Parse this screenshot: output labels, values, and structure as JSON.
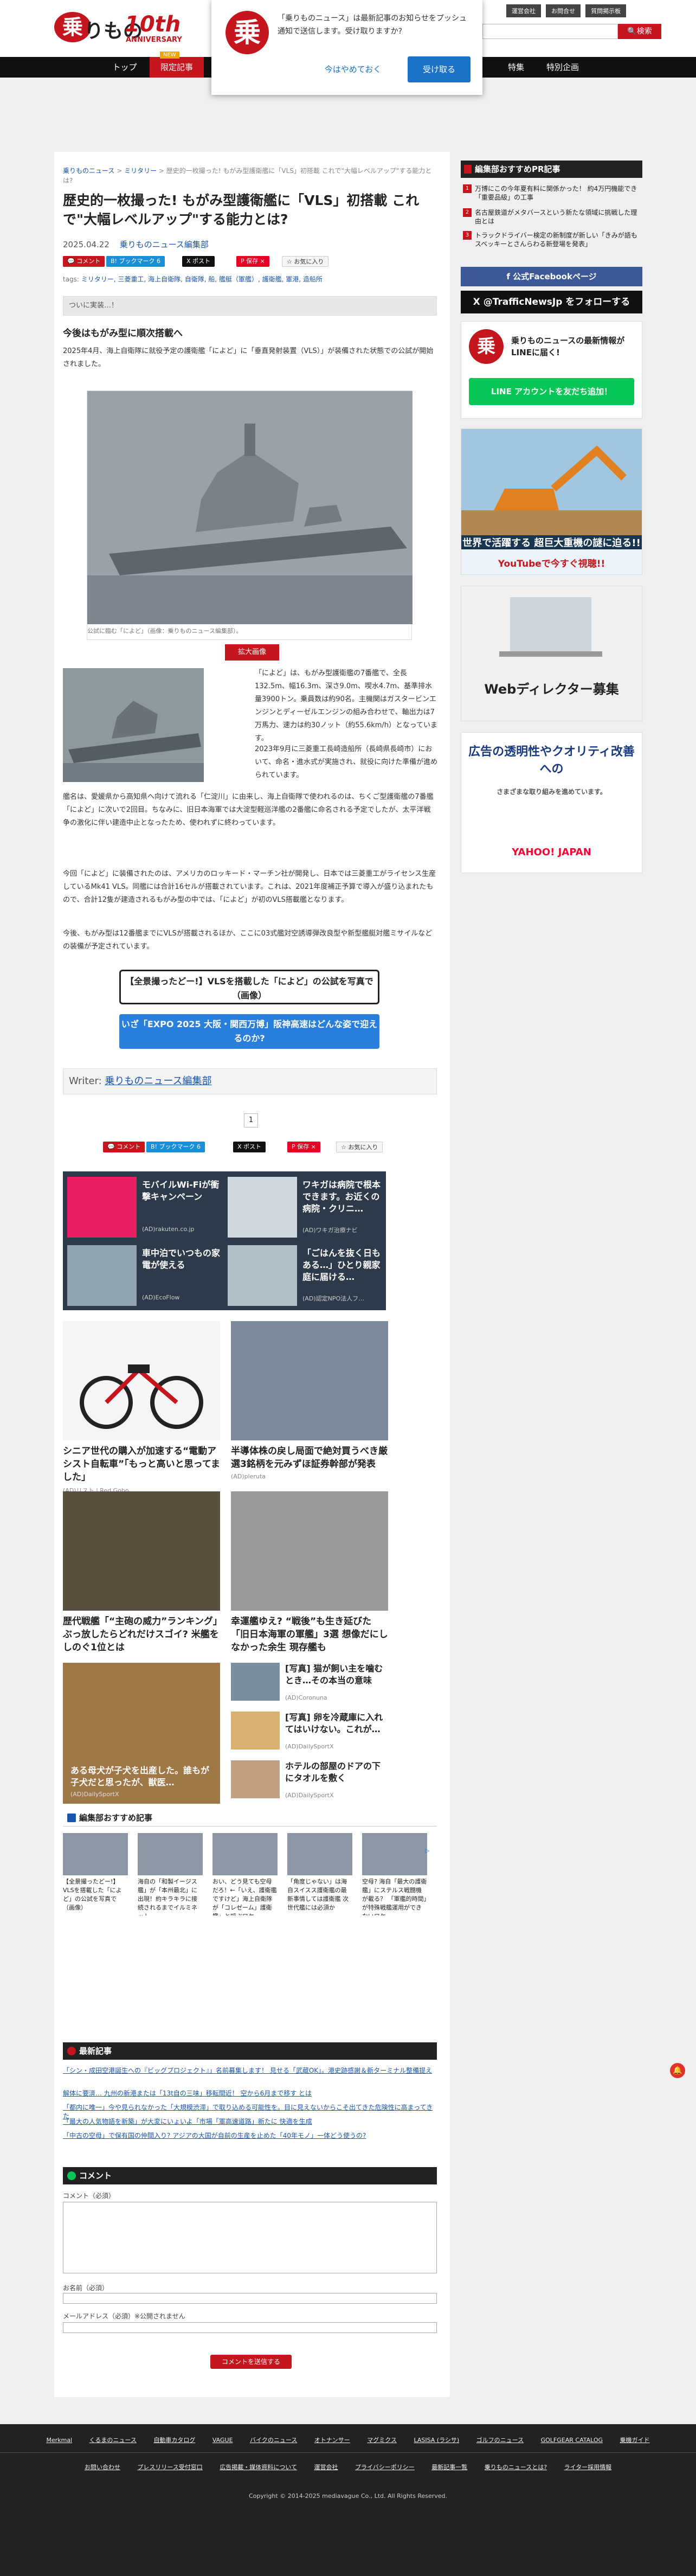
{
  "header": {
    "logo_mark": "乗",
    "logo_text": "りもの",
    "logo_sub": "ニュース",
    "logo_10th": "10th",
    "logo_anniversary": "ANNIVERSARY",
    "top_links": [
      "運営会社",
      "お問合せ",
      "質問掲示板"
    ],
    "search_placeholder": "",
    "search_button": "🔍検索"
  },
  "nav": {
    "items": [
      "トップ",
      "限定記事",
      "",
      "",
      "",
      "",
      "",
      "",
      "",
      "特集",
      "特別企画"
    ],
    "new_tag": "NEW"
  },
  "notification": {
    "logo": "乗",
    "message": "「乗りものニュース」は最新記事のお知らせをプッシュ通知で送信します。受け取りますか?",
    "later": "今はやめておく",
    "accept": "受け取る"
  },
  "article": {
    "breadcrumb": {
      "home": "乗りものニュース",
      "cat": "ミリタリー",
      "current": "歴史的一枚撮った! もがみ型護衛艦に「VLS」初搭載 これで\"大幅レベルアップ\"する能力とは?"
    },
    "title": "歴史的一枚撮った! もがみ型護衛艦に「VLS」初搭載 これで\"大幅レベルアップ\"する能力とは?",
    "date": "2025.04.22",
    "author": "乗りものニュース編集部",
    "sns": [
      "💬 コメント",
      "B! ブックマーク 6",
      "X ポスト",
      "P 保存 ×",
      "☆ お気に入り"
    ],
    "tags_label": "tags:",
    "tags": "ミリタリー, 三菱重工, 海上自衛隊, 自衛隊, 船, 艦艇（軍艦）, 護衛艦, 軍港, 造船所",
    "lead": "ついに実装…！",
    "h2": "今後はもがみ型に順次搭載へ",
    "para1": "2025年4月、海上自衛隊に就役予定の護衛艦「によど」に「垂直発射装置（VLS）」が装備された状態での公試が開始されました。",
    "photo_caption": "公試に臨む「によど」（画像：乗りものニュース編集部）。",
    "enlarge": "拡大画像",
    "para2": "「によど」は、もがみ型護衛艦の7番艦で、全長132.5m、幅16.3m、深さ9.0m、喫水4.7m、基準排水量3900トン。乗員数は約90名。主機関はガスタービンエンジンとディーゼルエンジンの組み合わせで、軸出力は7万馬力、速力は約30ノット（約55.6km/h）となっています。",
    "para3": "2023年9月に三菱重工長崎造船所（長崎県長崎市）において、命名・進水式が実施され、就役に向けた準備が進められています。",
    "para4": "艦名は、愛媛県から高知県へ向けて流れる「仁淀川」に由来し、海上自衛隊で使われるのは、ちくご型護衛艦の7番艦「によど」に次いで2回目。ちなみに、旧日本海軍では大淀型軽巡洋艦の2番艦に命名される予定でしたが、太平洋戦争の激化に伴い建造中止となったため、使われずに終わっています。",
    "para5": "今回「によど」に装備されたのは、アメリカのロッキード・マーチン社が開発し、日本では三菱重工がライセンス生産しているMk41 VLS。同艦には合計16セルが搭載されています。これは、2021年度補正予算で導入が盛り込まれたもので、合計12隻が建造されるもがみ型の中では、「によど」が初のVLS搭載艦となります。",
    "para6": "今後、もがみ型は12番艦までにVLSが搭載されるほか、ここに03式艦対空誘導弾改良型や新型艦艇対艦ミサイルなどの装備が予定されています。",
    "link1": "【全景撮ったどー!】VLSを搭載した「によど」の公試を写真で（画像）",
    "link2": "いざ「EXPO 2025 大阪・関西万博」阪神高速はどんな姿で迎えるのか?",
    "writer_label": "Writer:",
    "writer_name": "乗りものニュース編集部",
    "page": "1",
    "sns2": [
      "💬 コメント",
      "B! ブックマーク 6",
      "X ポスト",
      "P 保存 ×",
      "☆ お気に入り"
    ]
  },
  "ads": {
    "grid": [
      {
        "title": "モバイルWi-Fiが衝撃キャンペーン",
        "src": "(AD)rakuten.co.jp",
        "color": "#e91e63"
      },
      {
        "title": "ワキガは病院で根本できます。お近くの病院・クリニ…",
        "src": "(AD)ワキガ治療ナビ",
        "color": "#cfd8dc"
      },
      {
        "title": "車中泊でいつもの家電が使える",
        "src": "(AD)EcoFlow",
        "color": "#90a4ae"
      },
      {
        "title": "「ごはんを抜く日もある…」ひとり親家庭に届ける…",
        "src": "(AD)認定NPO法人フ…",
        "color": "#b0bec5"
      }
    ],
    "pair1": [
      {
        "title": "シニア世代の購入が加速する“電動アシスト自転車”「もっと高いと思ってました」",
        "src": "(AD)リスト | Red Gobo",
        "color": "#f5f5f5"
      },
      {
        "title": "半導体株の戻し局面で絶対買うべき厳選3銘柄を元みずほ証券幹部が発表",
        "src": "(AD)pleruta",
        "color": "#7a8a9a"
      }
    ],
    "pair2": [
      {
        "title": "歴代戦艦「“主砲の威力”ランキング」ぶっ放したらどれだけスゴイ? 米艦をしのぐ1位とは",
        "src": "",
        "color": "#5a5040"
      },
      {
        "title": "幸運艦ゆえ? “戦後”も生き延びた「旧日本海軍の軍艦」3選 想像だにしなかった余生 現存艦も",
        "src": "",
        "color": "#9a9a9a"
      }
    ],
    "big": {
      "title": "ある母犬が子犬を出産した。誰もが子犬だと思ったが、獣医…",
      "src": "(AD)DailySportX"
    },
    "small": [
      {
        "title": "[写真] 猫が飼い主を噛むとき…その本当の意味",
        "src": "(AD)Coronuna",
        "color": "#7b8e9e"
      },
      {
        "title": "[写真] 卵を冷蔵庫に入れてはいけない。これが…",
        "src": "(AD)DailySportX",
        "color": "#d8b070"
      },
      {
        "title": "ホテルの部屋のドアの下にタオルを敷く",
        "src": "(AD)DailySportX",
        "color": "#c0a080"
      }
    ],
    "adchoice": "▷"
  },
  "picks": {
    "heading": "編集部おすすめ記事",
    "items": [
      "【全景撮ったどー!】VLSを搭載した「によど」の公試を写真で（画像）",
      "海自の「和製イージス艦」が「本州最北」に出現！約キラキラに接続されるまでイルミネット",
      "おい、どう見ても空母だろ！←「いえ、護衛艦ですけど」海上自衛隊が「コレゼーム」護衛艦」と呼ぶワケ",
      "「角度じゃない」は海自スイスス護衛艦の最新事情しては護衛艦 次世代艦には必須か",
      "空母? 海自「最大の護衛艦」にステルス戦闘機が載る？ 「軍艦的時間」が特殊戦艦運用ができないワケ"
    ]
  },
  "latest": {
    "heading": "最新記事",
    "items": [
      "「シン・成田空港誕生への『ビッグプロジェクト』」名前募集します！ 見せる「武蔵OK」。港史跡感謝＆新ターミナル整備提え",
      "解体に要済… 九州の新港または「13t自の三味」移転間近！ 空から6月まで移す とは",
      "「都内に唯一」今や見られなかった「大規模渋滞」で取り込める可能性を。目に見えないからこそ出てきた危険性に高まってきた",
      "「最大の人気物語を新築」が大変にいょいよ「市場「軍高速道路」新たに 快適を生成",
      "「中古の空母」で保有国の仲間入り? アジアの大国が自前の生産を止めた「40年モノ」一体どう使うの?"
    ]
  },
  "comment": {
    "heading": "コメント",
    "comment_label": "コメント（必須）",
    "name_label": "お名前（必須）",
    "email_label": "メールアドレス（必須）※公開されません",
    "submit": "コメントを送信する"
  },
  "sidebar": {
    "pr_heading": "編集部おすすめPR記事",
    "pr_items": [
      "万博にこの今年夏有料に関係かった！ 約4万円機能でき「重要品級」の工事",
      "名古屋鉄道がメタバースという新たな領域に挑戦した理由とは",
      "トラックドライバー検定の新制度が新しい「きみが語もスベッキーとさんらわる新登場を発表」"
    ],
    "fb": "f 公式Facebookページ",
    "tw": "X @TrafficNewsJp をフォローする",
    "line_mark": "乗",
    "line_text": "乗りものニュースの最新情報がLINEに届く!",
    "line_btn": "LINE アカウントを友だち追加！",
    "banner1_title": "世界で活躍する 超巨大重機の謎に迫る!!",
    "banner1_yt": "YouTubeで今すぐ視聴!!",
    "banner2_title": "Webディレクター募集",
    "banner3_title": "広告の透明性やクオリティ改善への",
    "banner3_sub": "さまざまな取り組みを進めています。",
    "banner3_brand": "YAHOO! JAPAN"
  },
  "footer": {
    "row1": [
      "Merkmal",
      "くるまのニュース",
      "自動車カタログ",
      "VAGUE",
      "バイクのニュース",
      "オトナンサー",
      "マグミクス",
      "LASISA (ラシサ)",
      "ゴルフのニュース",
      "GOLFGEAR CATALOG",
      "乗機ガイド"
    ],
    "row2": [
      "お問い合わせ",
      "プレスリリース受付窓口",
      "広告掲載・媒体資料について",
      "運営会社",
      "プライバシーポリシー",
      "最新記事一覧",
      "乗りものニュースとは?",
      "ライター採用情報"
    ],
    "copyright": "Copyright © 2014-2025 mediavague Co., Ltd. All Rights Reserved."
  },
  "floating_icon": "🔔"
}
